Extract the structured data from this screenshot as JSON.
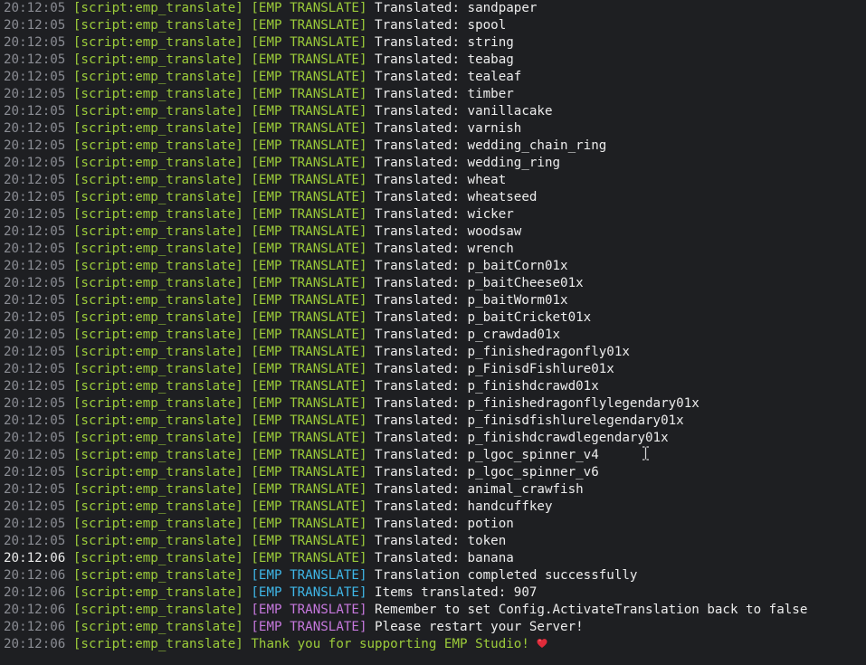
{
  "source": "[script:emp_translate]",
  "colors": {
    "background": "#1e1f22",
    "timestamp": "#8a8c93",
    "source_tag": "#9ccc3a",
    "tag_green": "#9ccc3a",
    "tag_cyan": "#3fb7e8",
    "tag_pink": "#c678dd",
    "message": "#ececec",
    "heart": "#e02b3a"
  },
  "lines": [
    {
      "time": "20:12:05",
      "tag": "[EMP TRANSLATE]",
      "tag_color": "green",
      "message": "Translated: sandpaper"
    },
    {
      "time": "20:12:05",
      "tag": "[EMP TRANSLATE]",
      "tag_color": "green",
      "message": "Translated: spool"
    },
    {
      "time": "20:12:05",
      "tag": "[EMP TRANSLATE]",
      "tag_color": "green",
      "message": "Translated: string"
    },
    {
      "time": "20:12:05",
      "tag": "[EMP TRANSLATE]",
      "tag_color": "green",
      "message": "Translated: teabag"
    },
    {
      "time": "20:12:05",
      "tag": "[EMP TRANSLATE]",
      "tag_color": "green",
      "message": "Translated: tealeaf"
    },
    {
      "time": "20:12:05",
      "tag": "[EMP TRANSLATE]",
      "tag_color": "green",
      "message": "Translated: timber"
    },
    {
      "time": "20:12:05",
      "tag": "[EMP TRANSLATE]",
      "tag_color": "green",
      "message": "Translated: vanillacake"
    },
    {
      "time": "20:12:05",
      "tag": "[EMP TRANSLATE]",
      "tag_color": "green",
      "message": "Translated: varnish"
    },
    {
      "time": "20:12:05",
      "tag": "[EMP TRANSLATE]",
      "tag_color": "green",
      "message": "Translated: wedding_chain_ring"
    },
    {
      "time": "20:12:05",
      "tag": "[EMP TRANSLATE]",
      "tag_color": "green",
      "message": "Translated: wedding_ring"
    },
    {
      "time": "20:12:05",
      "tag": "[EMP TRANSLATE]",
      "tag_color": "green",
      "message": "Translated: wheat"
    },
    {
      "time": "20:12:05",
      "tag": "[EMP TRANSLATE]",
      "tag_color": "green",
      "message": "Translated: wheatseed"
    },
    {
      "time": "20:12:05",
      "tag": "[EMP TRANSLATE]",
      "tag_color": "green",
      "message": "Translated: wicker"
    },
    {
      "time": "20:12:05",
      "tag": "[EMP TRANSLATE]",
      "tag_color": "green",
      "message": "Translated: woodsaw"
    },
    {
      "time": "20:12:05",
      "tag": "[EMP TRANSLATE]",
      "tag_color": "green",
      "message": "Translated: wrench"
    },
    {
      "time": "20:12:05",
      "tag": "[EMP TRANSLATE]",
      "tag_color": "green",
      "message": "Translated: p_baitCorn01x"
    },
    {
      "time": "20:12:05",
      "tag": "[EMP TRANSLATE]",
      "tag_color": "green",
      "message": "Translated: p_baitCheese01x"
    },
    {
      "time": "20:12:05",
      "tag": "[EMP TRANSLATE]",
      "tag_color": "green",
      "message": "Translated: p_baitWorm01x"
    },
    {
      "time": "20:12:05",
      "tag": "[EMP TRANSLATE]",
      "tag_color": "green",
      "message": "Translated: p_baitCricket01x"
    },
    {
      "time": "20:12:05",
      "tag": "[EMP TRANSLATE]",
      "tag_color": "green",
      "message": "Translated: p_crawdad01x"
    },
    {
      "time": "20:12:05",
      "tag": "[EMP TRANSLATE]",
      "tag_color": "green",
      "message": "Translated: p_finishedragonfly01x"
    },
    {
      "time": "20:12:05",
      "tag": "[EMP TRANSLATE]",
      "tag_color": "green",
      "message": "Translated: p_FinisdFishlure01x"
    },
    {
      "time": "20:12:05",
      "tag": "[EMP TRANSLATE]",
      "tag_color": "green",
      "message": "Translated: p_finishdcrawd01x"
    },
    {
      "time": "20:12:05",
      "tag": "[EMP TRANSLATE]",
      "tag_color": "green",
      "message": "Translated: p_finishedragonflylegendary01x"
    },
    {
      "time": "20:12:05",
      "tag": "[EMP TRANSLATE]",
      "tag_color": "green",
      "message": "Translated: p_finisdfishlurelegendary01x"
    },
    {
      "time": "20:12:05",
      "tag": "[EMP TRANSLATE]",
      "tag_color": "green",
      "message": "Translated: p_finishdcrawdlegendary01x"
    },
    {
      "time": "20:12:05",
      "tag": "[EMP TRANSLATE]",
      "tag_color": "green",
      "message": "Translated: p_lgoc_spinner_v4"
    },
    {
      "time": "20:12:05",
      "tag": "[EMP TRANSLATE]",
      "tag_color": "green",
      "message": "Translated: p_lgoc_spinner_v6"
    },
    {
      "time": "20:12:05",
      "tag": "[EMP TRANSLATE]",
      "tag_color": "green",
      "message": "Translated: animal_crawfish"
    },
    {
      "time": "20:12:05",
      "tag": "[EMP TRANSLATE]",
      "tag_color": "green",
      "message": "Translated: handcuffkey"
    },
    {
      "time": "20:12:05",
      "tag": "[EMP TRANSLATE]",
      "tag_color": "green",
      "message": "Translated: potion"
    },
    {
      "time": "20:12:05",
      "tag": "[EMP TRANSLATE]",
      "tag_color": "green",
      "message": "Translated: token"
    },
    {
      "time": "20:12:06",
      "tag": "[EMP TRANSLATE]",
      "tag_color": "green",
      "message": "Translated: banana",
      "time_bright": true
    },
    {
      "time": "20:12:06",
      "tag": "[EMP TRANSLATE]",
      "tag_color": "cyan",
      "message": "Translation completed successfully"
    },
    {
      "time": "20:12:06",
      "tag": "[EMP TRANSLATE]",
      "tag_color": "cyan",
      "message": "Items translated: 907"
    },
    {
      "time": "20:12:06",
      "tag": "[EMP TRANSLATE]",
      "tag_color": "pink",
      "message": "Remember to set Config.ActivateTranslation back to false"
    },
    {
      "time": "20:12:06",
      "tag": "[EMP TRANSLATE]",
      "tag_color": "pink",
      "message": "Please restart your Server!"
    },
    {
      "time": "20:12:06",
      "tag": "",
      "tag_color": "none",
      "message": "Thank you for supporting EMP Studio!",
      "message_color": "green",
      "icon": "heart-icon"
    }
  ]
}
